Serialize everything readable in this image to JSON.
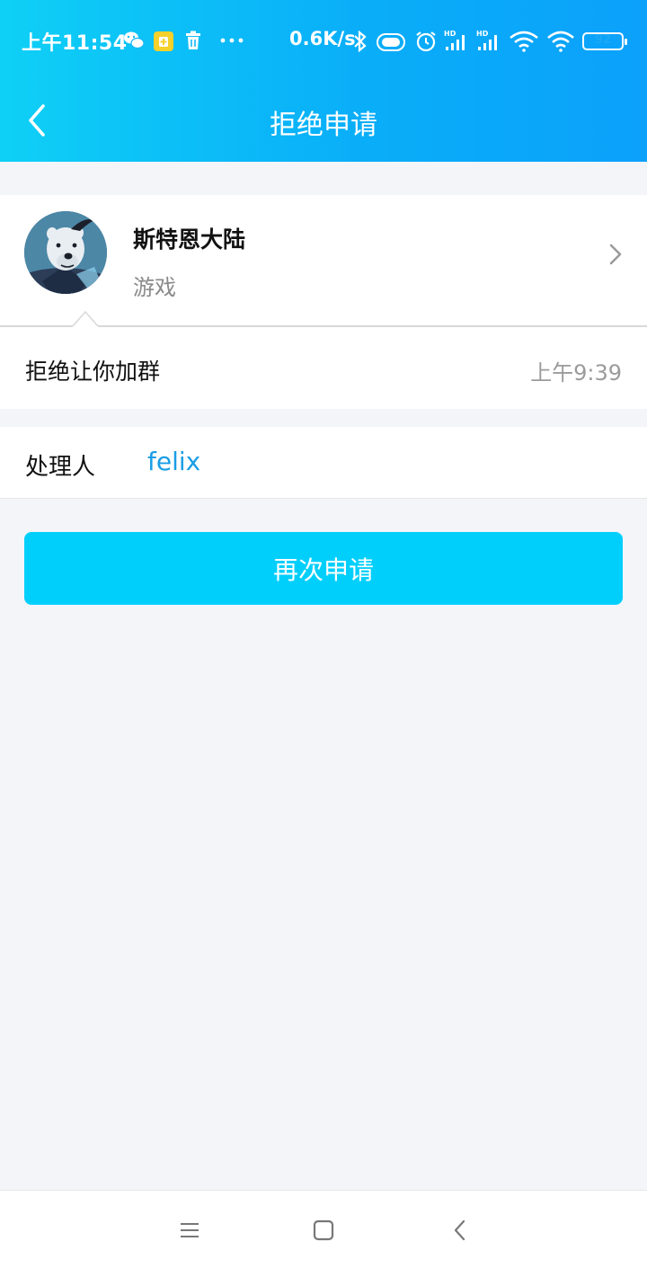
{
  "status_bar": {
    "time": "上午11:54",
    "network_speed": "0.6K/s",
    "battery_level": "92",
    "battery_fraction": 0.92,
    "icons": [
      "wechat-icon",
      "app-notification-icon",
      "trash-icon",
      "more-dots-icon",
      "bluetooth-icon",
      "vibrate-icon",
      "alarm-icon",
      "hd-signal-icon",
      "hd-signal-icon",
      "wifi-icon",
      "wifi-icon",
      "battery-icon"
    ]
  },
  "nav": {
    "title": "拒绝申请"
  },
  "group": {
    "name": "斯特恩大陆",
    "category": "游戏"
  },
  "notice": {
    "text": "拒绝让你加群",
    "time": "上午9:39"
  },
  "handler": {
    "label": "处理人",
    "value": "felix"
  },
  "actions": {
    "reapply_label": "再次申请"
  },
  "colors": {
    "header_gradient_start": "#0ed0f6",
    "header_gradient_end": "#0ba1fb",
    "button": "#00cffc",
    "handler_link": "#1a9de6",
    "page_background": "#f3f5f9"
  }
}
